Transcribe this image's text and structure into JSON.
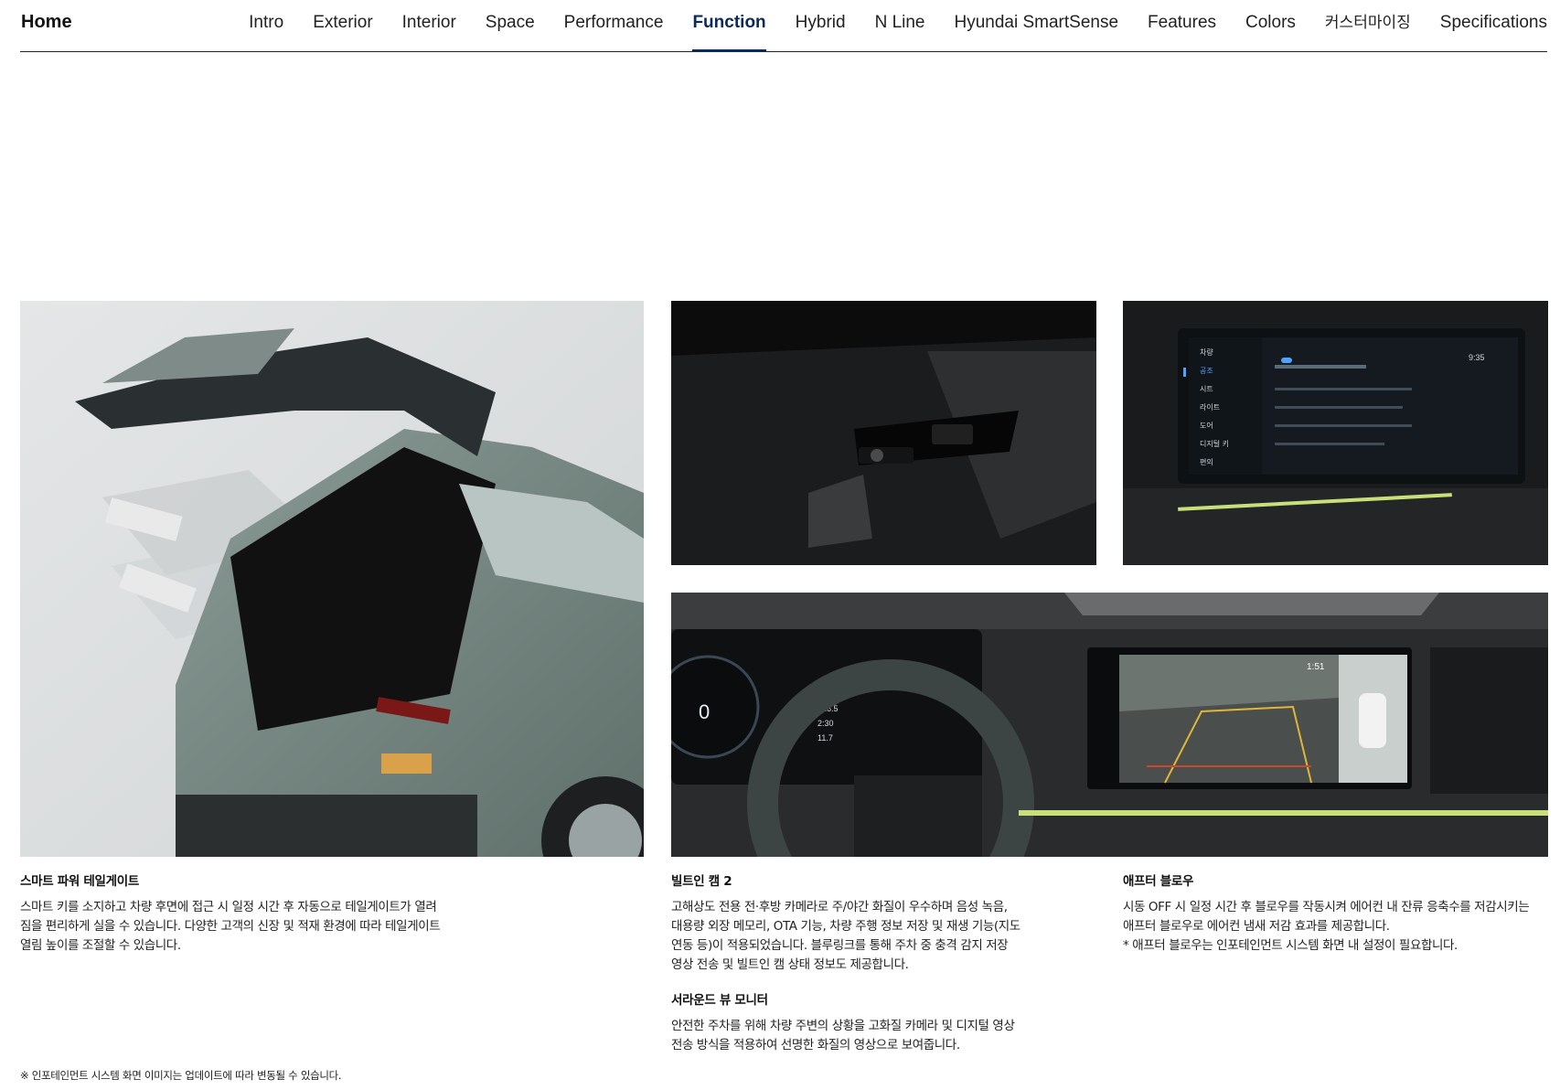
{
  "nav": {
    "home": "Home",
    "tabs": [
      {
        "label": "Intro"
      },
      {
        "label": "Exterior"
      },
      {
        "label": "Interior"
      },
      {
        "label": "Space"
      },
      {
        "label": "Performance"
      },
      {
        "label": "Function",
        "active": true
      },
      {
        "label": "Hybrid"
      },
      {
        "label": "N Line"
      },
      {
        "label": "Hyundai SmartSense"
      },
      {
        "label": "Features"
      },
      {
        "label": "Colors"
      },
      {
        "label": "커스터마이징"
      },
      {
        "label": "Specifications"
      }
    ]
  },
  "features": [
    {
      "title": "스마트 파워 테일게이트",
      "lines": [
        "스마트 키를 소지하고 차량 후면에 접근 시 일정 시간 후 자동으로 테일게이트가 열려",
        "짐을 편리하게 실을 수 있습니다. 다양한 고객의 신장 및 적재 환경에 따라 테일게이트",
        "열림 높이를 조절할 수 있습니다."
      ]
    },
    {
      "title": "빌트인 캠 2",
      "lines": [
        "고해상도 전용 전·후방 카메라로 주/야간 화질이 우수하며 음성 녹음,",
        "대용량 외장 메모리, OTA 기능, 차량 주행 정보 저장 및 재생 기능(지도",
        "연동 등)이 적용되었습니다. 블루링크를 통해 주차 중 충격 감지 저장",
        "영상 전송 및 빌트인 캠 상태 정보도 제공합니다."
      ]
    },
    {
      "title": "서라운드 뷰 모니터",
      "lines": [
        "안전한 주차를 위해 차량 주변의 상황을 고화질 카메라 및 디지털 영상",
        "전송 방식을 적용하여 선명한 화질의 영상으로 보여줍니다."
      ]
    },
    {
      "title": "애프터 블로우",
      "lines": [
        "시동 OFF 시 일정 시간 후 블로우를 작동시켜 에어컨 내 잔류 응축수를 저감시키는",
        "애프터 블로우로 에어컨 냄새 저감 효과를 제공합니다.",
        "* 애프터 블로우는 인포테인먼트 시스템 화면 내 설정이 필요합니다."
      ]
    }
  ],
  "footnote": "※ 인포테인먼트 시스템 화면 이미지는 업데이트에 따라 변동될 수 있습니다.",
  "screens": {
    "infotainment_time": "9:35",
    "infotainment_menu": [
      "차량",
      "공조",
      "시트",
      "라이트",
      "도어",
      "디지털 키",
      "편의"
    ],
    "cluster_speed": "0",
    "cluster_values": [
      "126.5",
      "2:30",
      "11.7"
    ],
    "svm_time": "1:51"
  },
  "colors": {
    "accent": "#0a2a5c",
    "body_green": "#6f817c",
    "lime_strip": "#c9e07a"
  }
}
